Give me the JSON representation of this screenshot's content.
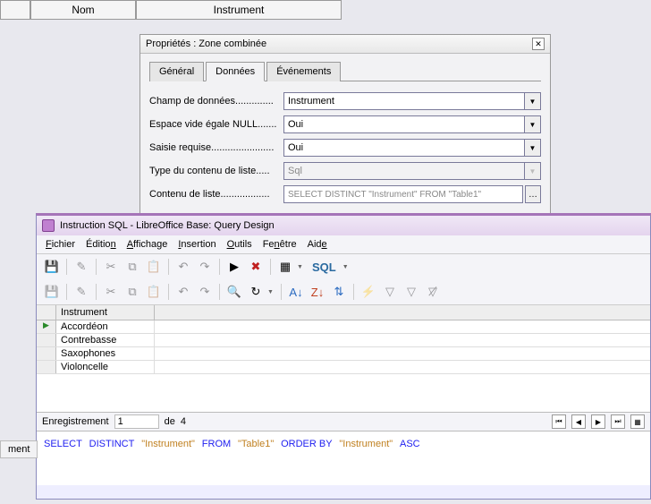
{
  "sheet": {
    "col_blank": "",
    "col1": "Nom",
    "col2": "Instrument"
  },
  "props": {
    "title": "Propriétés : Zone combinée",
    "tabs": {
      "general": "Général",
      "data": "Données",
      "events": "Événements"
    },
    "rows": {
      "champ": {
        "label": "Champ de données..............",
        "value": "Instrument"
      },
      "vide": {
        "label": "Espace vide égale NULL.......",
        "value": "Oui"
      },
      "saisie": {
        "label": "Saisie requise.......................",
        "value": "Oui"
      },
      "type": {
        "label": "Type du contenu de liste.....",
        "value": "Sql"
      },
      "contenu": {
        "label": "Contenu de liste..................",
        "value": "SELECT DISTINCT \"Instrument\" FROM \"Table1\""
      }
    }
  },
  "query": {
    "title": "Instruction SQL - LibreOffice Base: Query Design",
    "menus": {
      "fichier": "Fichier",
      "edition": "Édition",
      "affichage": "Affichage",
      "insertion": "Insertion",
      "outils": "Outils",
      "fenetre": "Fenêtre",
      "aide": "Aide"
    },
    "sql_btn": "SQL",
    "grid": {
      "header": "Instrument",
      "rows": [
        "Accordéon",
        "Contrebasse",
        "Saxophones",
        "Violoncelle"
      ]
    },
    "nav": {
      "label": "Enregistrement",
      "current": "1",
      "of": "de",
      "total": "4"
    },
    "sql_tokens": {
      "select": "SELECT",
      "distinct": "DISTINCT",
      "from": "FROM",
      "orderby": "ORDER BY",
      "asc": "ASC",
      "instrument": "\"Instrument\"",
      "table1": "\"Table1\""
    }
  },
  "frag": "ment"
}
